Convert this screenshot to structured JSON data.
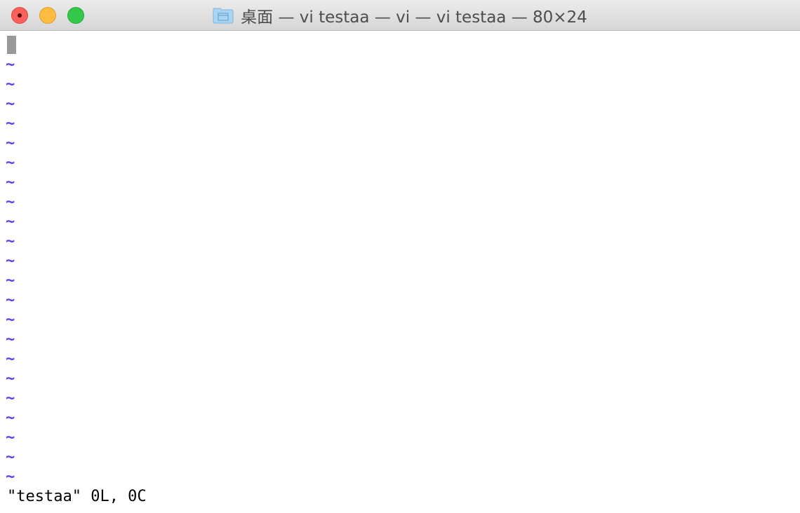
{
  "window": {
    "title": "桌面 — vi testaa — vi — vi testaa — 80×24",
    "folder_icon": "folder-icon",
    "buttons": {
      "close": "close-button",
      "minimize": "minimize-button",
      "maximize": "maximize-button"
    },
    "colors": {
      "close": "#fc605b",
      "minimize": "#fdbc40",
      "maximize": "#34c84a"
    }
  },
  "editor": {
    "empty_line_marker": "~",
    "empty_line_count": 22,
    "tilde_color": "#5b3df0",
    "status_line": "\"testaa\" 0L, 0C"
  }
}
